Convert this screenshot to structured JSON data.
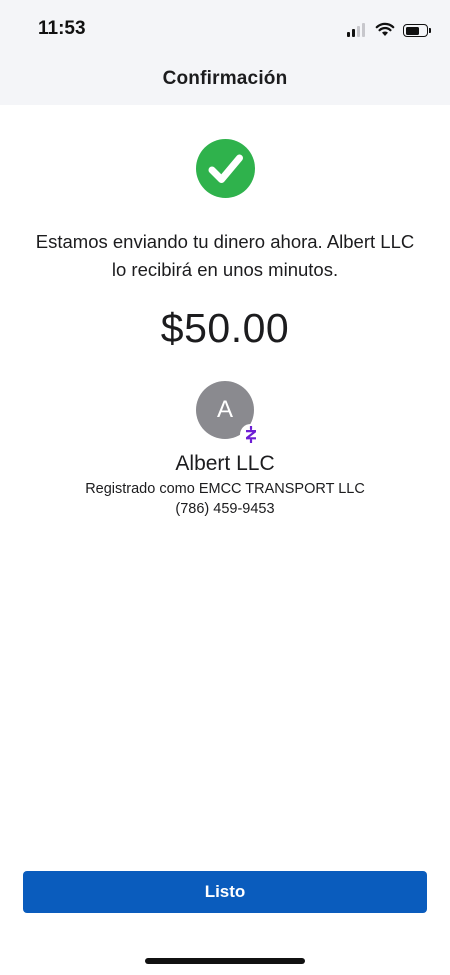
{
  "status_bar": {
    "time": "11:53",
    "signal_bars_active": 2,
    "signal_bars_total": 4,
    "battery_level": 0.68
  },
  "header": {
    "title": "Confirmación"
  },
  "confirmation": {
    "icon": "checkmark-circle",
    "icon_color": "#2fb24c",
    "message": "Estamos enviando tu dinero ahora. Albert LLC lo recibirá en unos minutos.",
    "amount": "$50.00"
  },
  "recipient": {
    "initial": "A",
    "badge_icon": "zelle-icon",
    "badge_color": "#6d1ed4",
    "name": "Albert LLC",
    "registered_as": "Registrado como EMCC TRANSPORT LLC",
    "phone": "(786) 459-9453"
  },
  "footer": {
    "done_label": "Listo",
    "button_color": "#0a5cbd"
  }
}
